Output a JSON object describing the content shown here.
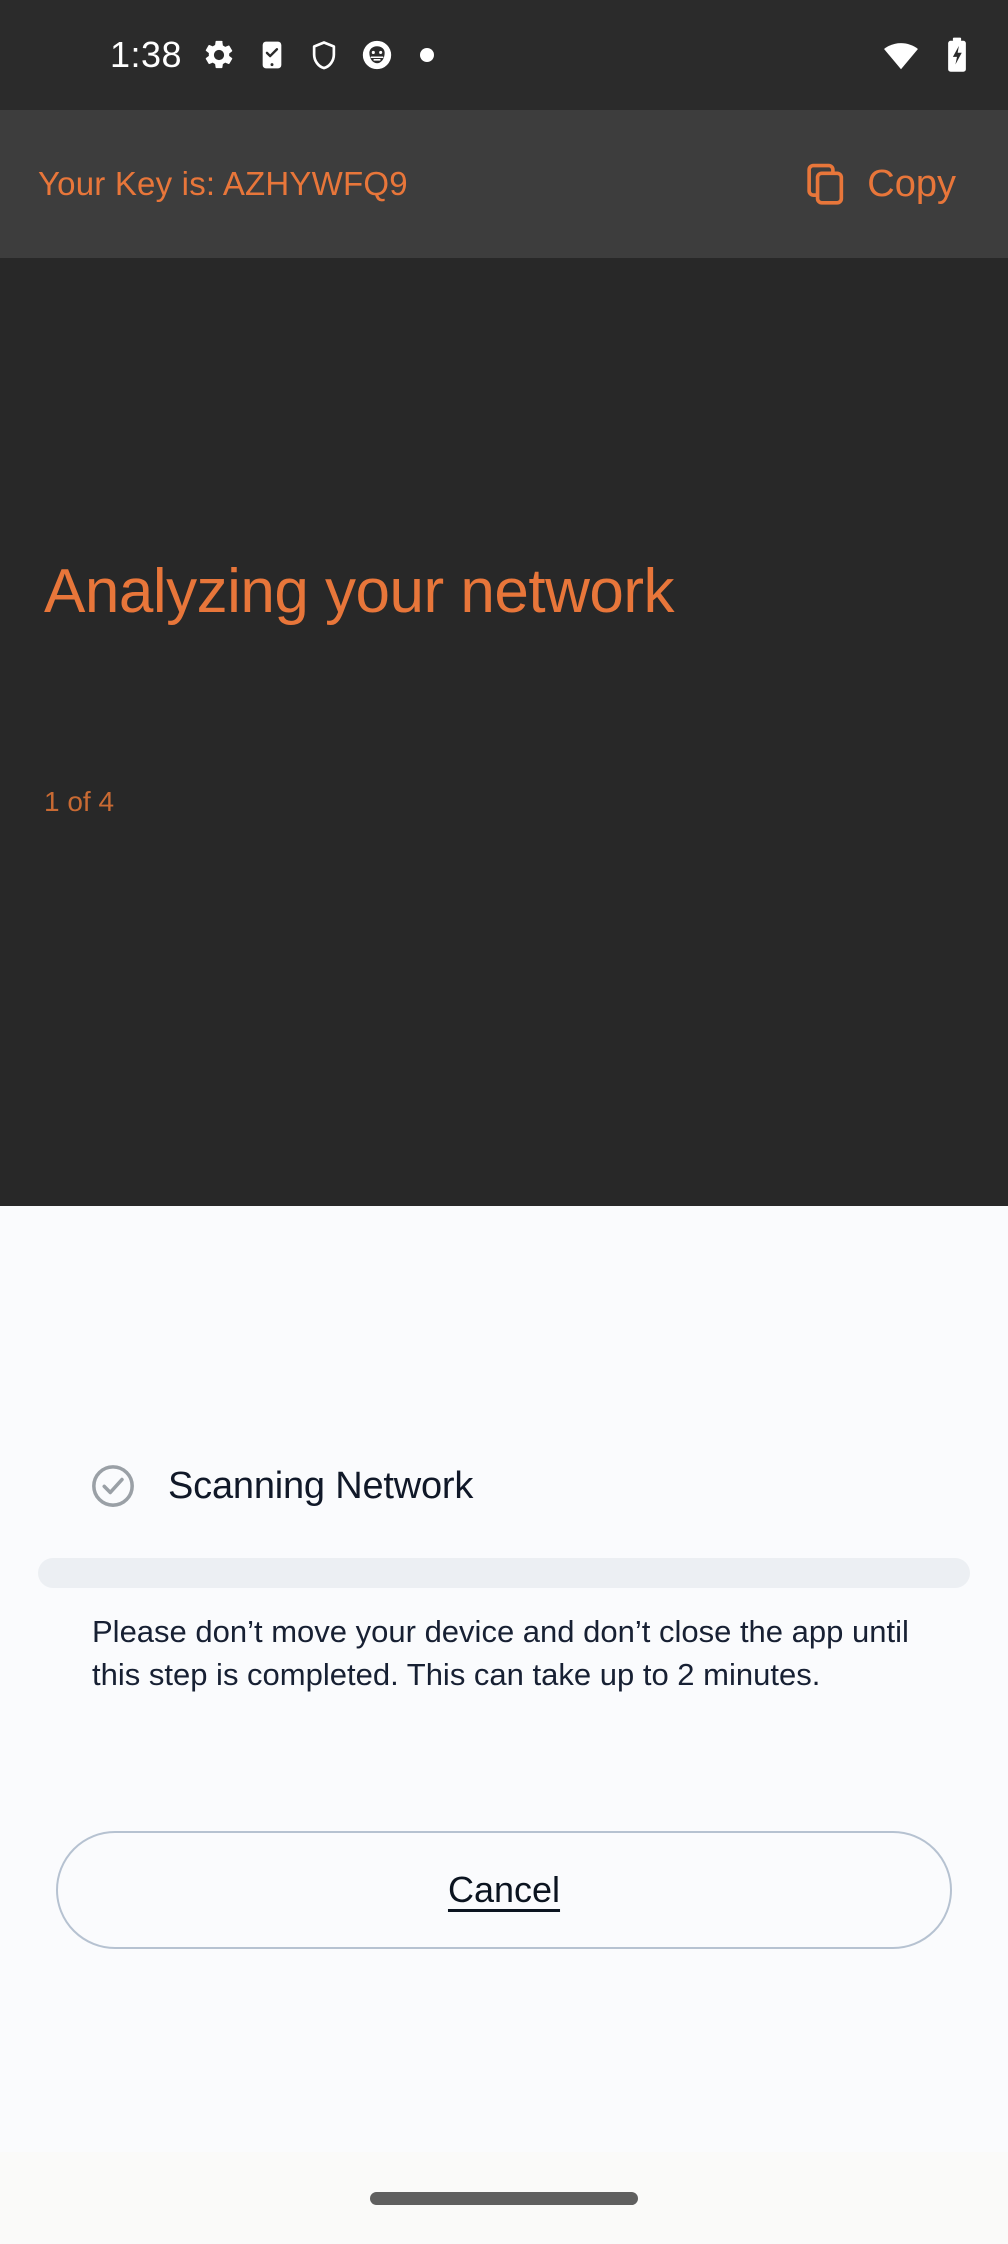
{
  "status_bar": {
    "clock": "1:38",
    "left_icons": [
      "gear-icon",
      "phone-check-icon",
      "shield-icon",
      "app-circle-icon",
      "dot-icon"
    ],
    "right_icons": [
      "wifi-icon",
      "battery-charging-icon"
    ]
  },
  "key_bar": {
    "key_text": "Your Key is: AZHYWFQ9",
    "key_value": "AZHYWFQ9",
    "copy_label": "Copy",
    "copy_icon": "copy-icon",
    "accent_color": "#e8763a",
    "background_color": "#3d3d3d"
  },
  "hero": {
    "title": "Analyzing your network",
    "step_counter": "1 of 4",
    "current_step": 1,
    "total_steps": 4,
    "background_color": "#282828",
    "title_color": "#e8763a"
  },
  "panel": {
    "step_icon": "check-circle-icon",
    "step_title": "Scanning Network",
    "progress_percent": 0,
    "progress_track_color": "#eceff3",
    "progress_fill_color": "#e8763a",
    "body_text": "Please don’t move your device and don’t close the app until this step is completed. This can take up to 2 minutes.",
    "cancel_label": "Cancel",
    "background_color": "#fafbfd"
  },
  "nav_bar": {
    "handle": "gesture-handle",
    "background_color": "#fafaf9"
  }
}
